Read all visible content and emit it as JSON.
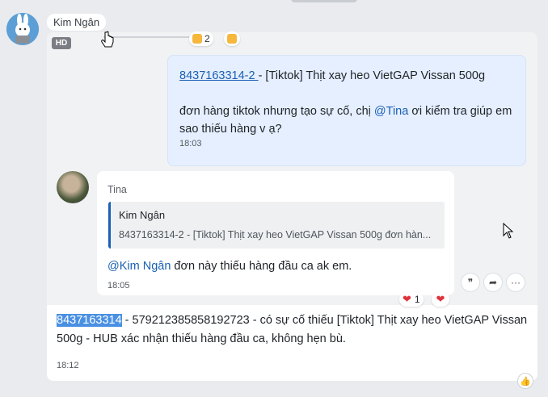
{
  "sender": {
    "name": "Kim Ngân",
    "hd_label": "HD"
  },
  "reactions_top": {
    "count": "2",
    "icon": "thumbs-up"
  },
  "msg1": {
    "link": "8437163314-2 ",
    "title": "- [Tiktok] Thịt xay heo VietGAP Vissan 500g",
    "before": "đơn hàng tiktok nhưng tạo sự cố, chị ",
    "mention": "@Tina",
    "after": " ơi kiểm tra  giúp em sao thiếu hàng  v ạ?",
    "time": "18:03"
  },
  "reply": {
    "author": "Tina",
    "quote_name": "Kim Ngân",
    "quote_text": "8437163314-2 - [Tiktok] Thịt xay heo VietGAP Vissan 500g đơn hàn...",
    "mention": "@Kim Ngân",
    "text": " đơn này thiếu hàng đầu ca ak em.",
    "time": "18:05"
  },
  "reactions_bottom": {
    "count": "1"
  },
  "msg3": {
    "highlight": "8437163314",
    "text": " - 579212385858192723 - có sự cố thiếu [Tiktok] Thịt xay heo VietGAP Vissan 500g  - HUB xác  nhận thiếu hàng đầu ca, không hẹn bù.",
    "time": "18:12"
  },
  "colors": {
    "accent": "#1a5fb4",
    "highlight": "#4a90e2",
    "heart": "#e0323b"
  }
}
